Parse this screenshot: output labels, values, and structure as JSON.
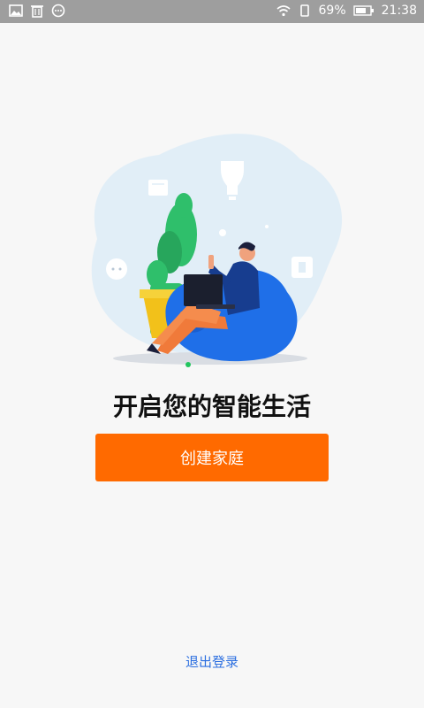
{
  "status_bar": {
    "battery": "69%",
    "time": "21:38",
    "left_icons": [
      "image-icon",
      "trash-icon",
      "message-icon"
    ],
    "right_icons": [
      "wifi-icon",
      "sim-icon",
      "battery-icon"
    ]
  },
  "main": {
    "title": "开启您的智能生活",
    "create_button_label": "创建家庭",
    "logout_label": "退出登录"
  },
  "colors": {
    "accent": "#ff6a00",
    "link": "#2c6fe0",
    "indicator": "#22c55e"
  }
}
